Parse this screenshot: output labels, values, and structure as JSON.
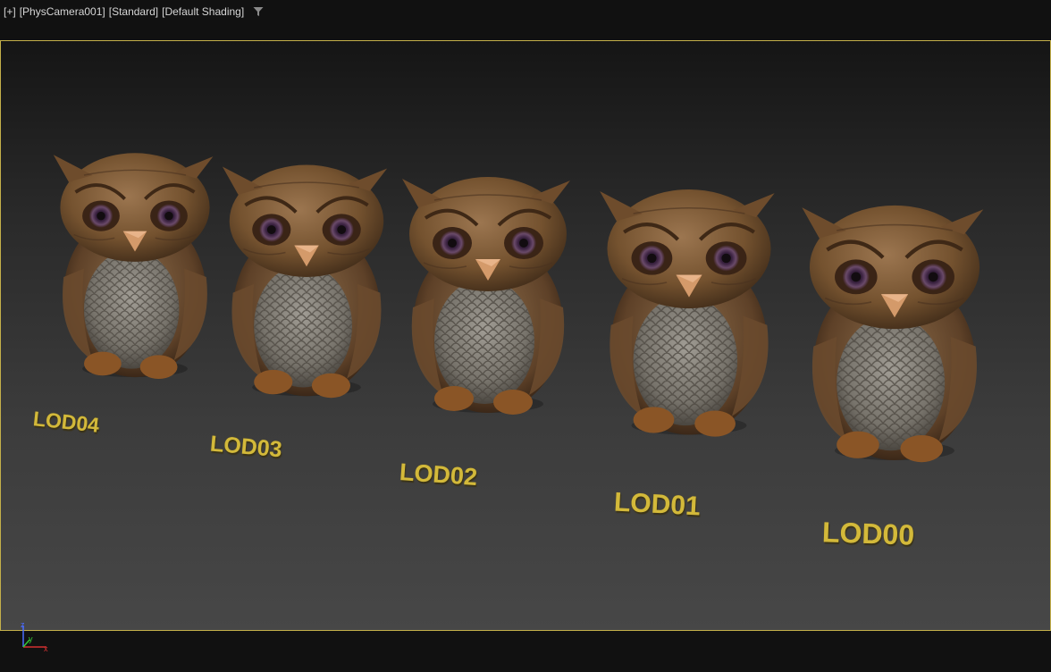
{
  "viewport": {
    "labels": [
      "[+]",
      "[PhysCamera001]",
      "[Standard]",
      "[Default Shading]"
    ],
    "filter_icon": "filter-funnel-icon",
    "border_color": "#c4b04a"
  },
  "scene": {
    "lods": [
      "LOD04",
      "LOD03",
      "LOD02",
      "LOD01",
      "LOD00"
    ],
    "label_color": "#d3b93a"
  },
  "axis_gizmo": {
    "x_label": "x",
    "y_label": "y",
    "z_label": "z",
    "x_color": "#d23030",
    "y_color": "#34c834",
    "z_color": "#4a6cff"
  }
}
